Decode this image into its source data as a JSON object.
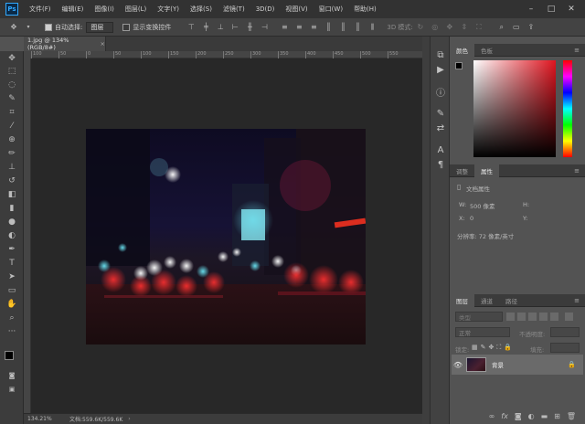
{
  "app": {
    "logo": "Ps"
  },
  "menu": [
    "文件(F)",
    "编辑(E)",
    "图像(I)",
    "图层(L)",
    "文字(Y)",
    "选择(S)",
    "滤镜(T)",
    "3D(D)",
    "视图(V)",
    "窗口(W)",
    "帮助(H)"
  ],
  "options": {
    "auto_select_label": "自动选择:",
    "auto_select_value": "图层",
    "show_transform_label": "显示变换控件",
    "mode_3d_label": "3D 模式:"
  },
  "document": {
    "tab_title": "1.jpg @ 134%(RGB/8#)",
    "zoom": "134.21%",
    "doc_size": "文档:559.6K/559.6K"
  },
  "ruler": {
    "top_ticks": [
      "100",
      "50",
      "0",
      "50",
      "100",
      "150",
      "200",
      "250",
      "300",
      "350",
      "400",
      "450",
      "500",
      "550"
    ]
  },
  "color_panel": {
    "tabs": [
      "颜色",
      "色板"
    ],
    "hue_color": "#e0141f"
  },
  "properties_panel": {
    "tabs": [
      "调整",
      "属性"
    ],
    "title": "文档属性",
    "w_label": "W:",
    "w_value": "500 像素",
    "h_label": "H:",
    "x_label": "X:",
    "x_value": "0",
    "y_label": "Y:",
    "resolution": "分辨率: 72 像素/英寸"
  },
  "layers_panel": {
    "tabs": [
      "图层",
      "通道",
      "路径"
    ],
    "search_placeholder": "类型",
    "blend_mode": "正常",
    "opacity_label": "不透明度:",
    "lock_label": "锁定:",
    "fill_label": "填充:",
    "layer_name": "背景"
  },
  "colors": {
    "accent": "#31a8ff",
    "menubar": "#323232",
    "panel": "#535353"
  }
}
